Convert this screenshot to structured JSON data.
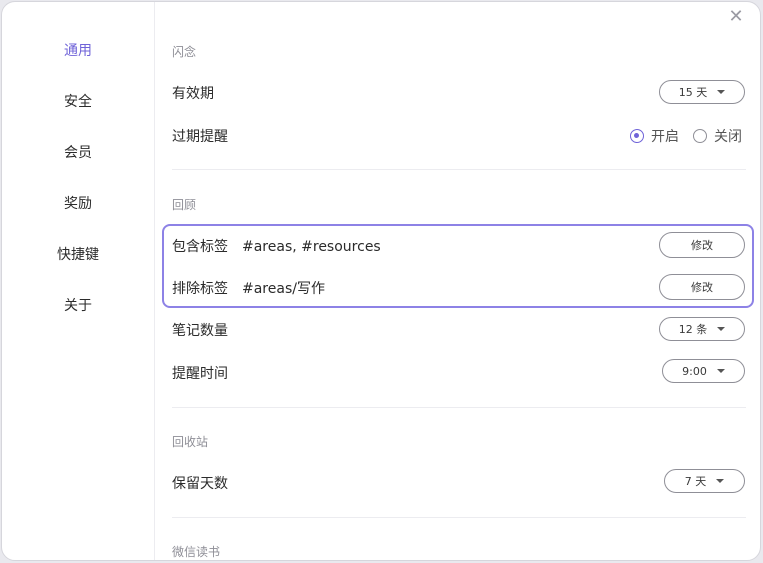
{
  "sidebar": {
    "items": [
      {
        "label": "通用",
        "active": true
      },
      {
        "label": "安全",
        "active": false
      },
      {
        "label": "会员",
        "active": false
      },
      {
        "label": "奖励",
        "active": false
      },
      {
        "label": "快捷键",
        "active": false
      },
      {
        "label": "关于",
        "active": false
      }
    ]
  },
  "close_icon": "close-icon",
  "sections": {
    "flash": {
      "title": "闪念",
      "validity_label": "有效期",
      "validity_value": "15 天",
      "reminder_label": "过期提醒",
      "reminder_on": "开启",
      "reminder_off": "关闭",
      "reminder_selected": "开启"
    },
    "review": {
      "title": "回顾",
      "include_label": "包含标签",
      "include_value": "#areas, #resources",
      "exclude_label": "排除标签",
      "exclude_value": "#areas/写作",
      "edit_label": "修改",
      "count_label": "笔记数量",
      "count_value": "12 条",
      "time_label": "提醒时间",
      "time_value": "9:00"
    },
    "trash": {
      "title": "回收站",
      "days_label": "保留天数",
      "days_value": "7 天"
    },
    "weread": {
      "title": "微信读书"
    }
  },
  "colors": {
    "accent": "#6f63d8",
    "highlight_border": "#8d82e6"
  }
}
